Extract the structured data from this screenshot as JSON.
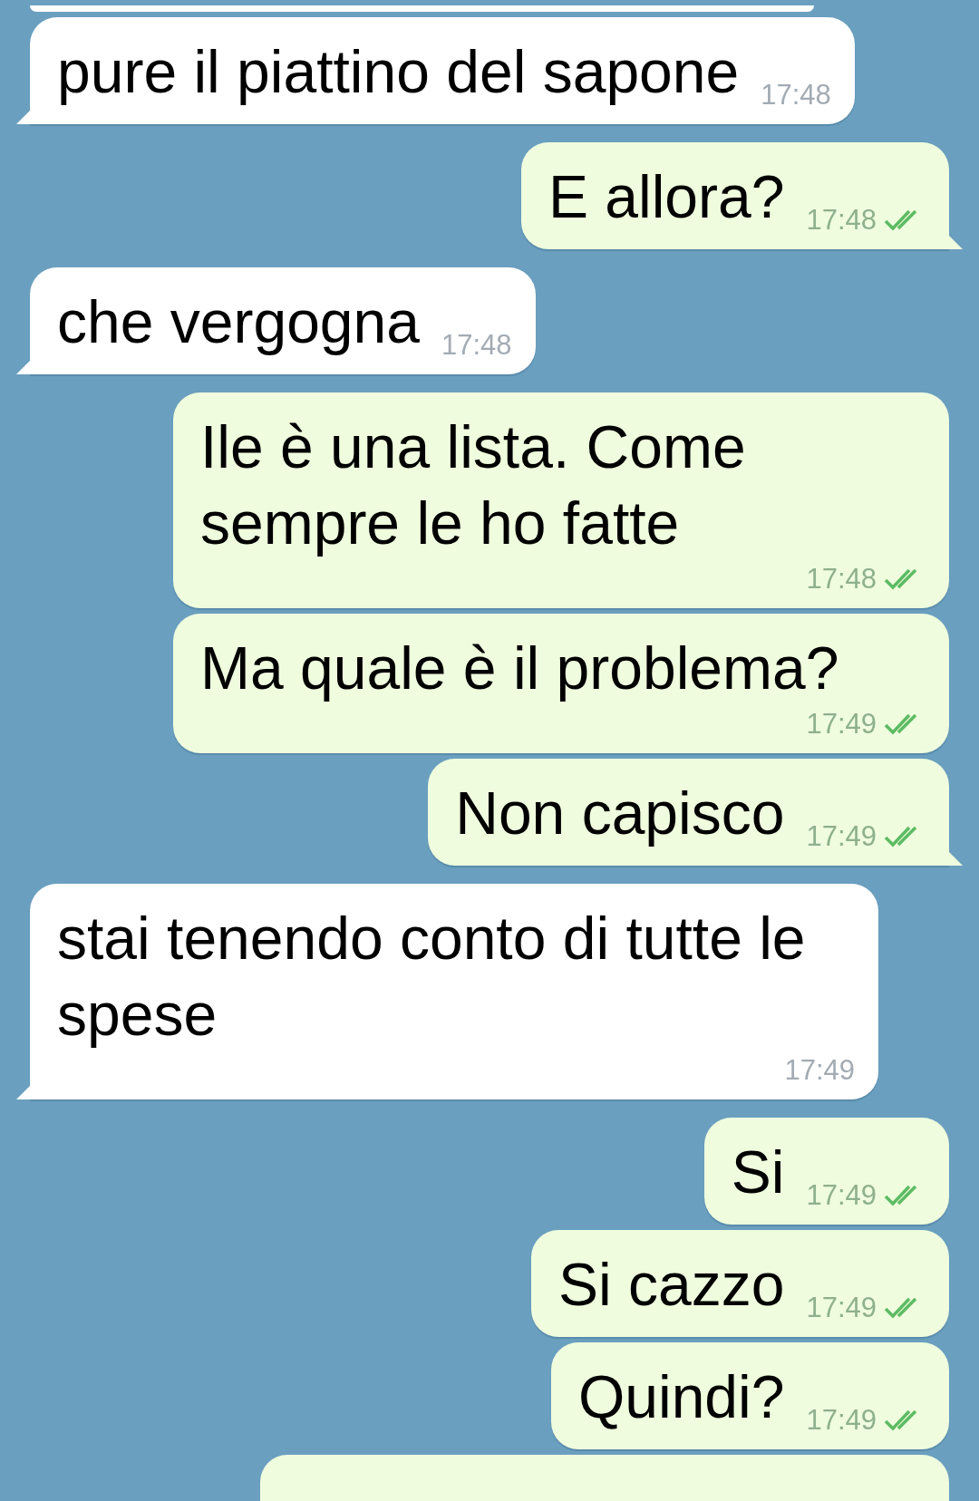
{
  "messages": [
    {
      "outgoing": false,
      "kind": "partial_top"
    },
    {
      "outgoing": false,
      "kind": "message",
      "text": "pure il piattino del sapone",
      "time": "17:48",
      "tail": true
    },
    {
      "outgoing": true,
      "kind": "message",
      "text": "E allora?",
      "time": "17:48",
      "read": true,
      "tail": true
    },
    {
      "outgoing": false,
      "kind": "message",
      "text": "che vergogna",
      "time": "17:48",
      "tail": true
    },
    {
      "outgoing": true,
      "kind": "message",
      "text": "Ile è una lista. Come sempre le ho fatte",
      "time": "17:48",
      "read": true,
      "tail": false
    },
    {
      "outgoing": true,
      "kind": "message",
      "text": "Ma quale è il problema?",
      "time": "17:49",
      "read": true,
      "tail": false
    },
    {
      "outgoing": true,
      "kind": "message",
      "text": "Non capisco",
      "time": "17:49",
      "read": true,
      "tail": true
    },
    {
      "outgoing": false,
      "kind": "message",
      "text": "stai tenendo conto di tutte le spese",
      "time": "17:49",
      "tail": true
    },
    {
      "outgoing": true,
      "kind": "message",
      "text": "Si",
      "time": "17:49",
      "read": true,
      "tail": false
    },
    {
      "outgoing": true,
      "kind": "message",
      "text": "Si cazzo",
      "time": "17:49",
      "read": true,
      "tail": false
    },
    {
      "outgoing": true,
      "kind": "message",
      "text": "Quindi?",
      "time": "17:49",
      "read": true,
      "tail": false
    },
    {
      "outgoing": true,
      "kind": "partial_bottom"
    }
  ]
}
